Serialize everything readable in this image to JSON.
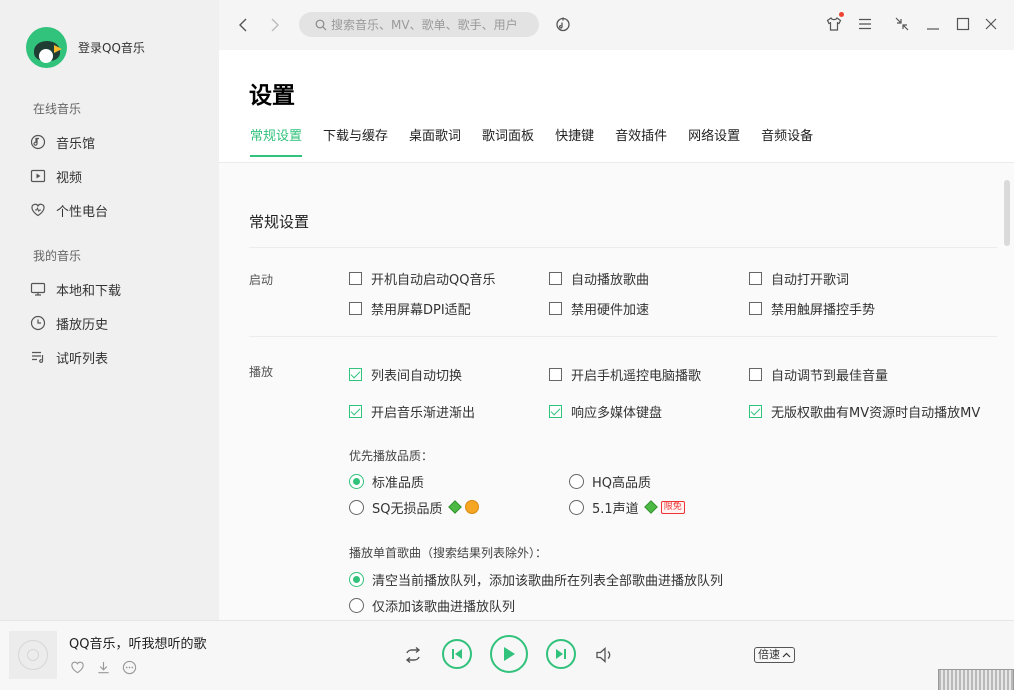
{
  "sidebar": {
    "login_label": "登录QQ音乐",
    "online_section": "在线音乐",
    "online_items": [
      {
        "label": "音乐馆",
        "icon": "music-hall-icon"
      },
      {
        "label": "视频",
        "icon": "video-icon"
      },
      {
        "label": "个性电台",
        "icon": "radio-heart-icon"
      }
    ],
    "my_section": "我的音乐",
    "my_items": [
      {
        "label": "本地和下载",
        "icon": "monitor-icon"
      },
      {
        "label": "播放历史",
        "icon": "clock-icon"
      },
      {
        "label": "试听列表",
        "icon": "playlist-icon"
      }
    ]
  },
  "topbar": {
    "search_placeholder": "搜索音乐、MV、歌单、歌手、用户"
  },
  "settings": {
    "title": "设置",
    "tabs": [
      "常规设置",
      "下载与缓存",
      "桌面歌词",
      "歌词面板",
      "快捷键",
      "音效插件",
      "网络设置",
      "音频设备"
    ],
    "active_tab": "常规设置",
    "section_title": "常规设置",
    "startup": {
      "label": "启动",
      "options": [
        {
          "label": "开机自动启动QQ音乐",
          "checked": false
        },
        {
          "label": "自动播放歌曲",
          "checked": false
        },
        {
          "label": "自动打开歌词",
          "checked": false
        },
        {
          "label": "禁用屏幕DPI适配",
          "checked": false
        },
        {
          "label": "禁用硬件加速",
          "checked": false
        },
        {
          "label": "禁用触屏播控手势",
          "checked": false
        }
      ]
    },
    "playback": {
      "label": "播放",
      "options": [
        {
          "label": "列表间自动切换",
          "checked": true
        },
        {
          "label": "开启手机遥控电脑播歌",
          "checked": false
        },
        {
          "label": "自动调节到最佳音量",
          "checked": false
        },
        {
          "label": "开启音乐渐进渐出",
          "checked": true
        },
        {
          "label": "响应多媒体键盘",
          "checked": true
        },
        {
          "label": "无版权歌曲有MV资源时自动播放MV",
          "checked": true
        }
      ],
      "quality_label": "优先播放品质：",
      "quality_options": [
        {
          "label": "标准品质",
          "checked": true
        },
        {
          "label": "HQ高品质",
          "checked": false
        },
        {
          "label": "SQ无损品质",
          "checked": false
        },
        {
          "label": "5.1声道",
          "checked": false,
          "badge": "限免"
        }
      ],
      "single_label": "播放单首歌曲（搜索结果列表除外）：",
      "single_options": [
        {
          "label": "清空当前播放队列，添加该歌曲所在列表全部歌曲进播放队列",
          "checked": true
        },
        {
          "label": "仅添加该歌曲进播放队列",
          "checked": false
        }
      ]
    }
  },
  "player": {
    "song_title": "QQ音乐，听我想听的歌",
    "speed_label": "倍速"
  },
  "colors": {
    "accent": "#31c27c",
    "sidebar_bg": "#f0f0f0",
    "red_dot": "#f1422f"
  }
}
